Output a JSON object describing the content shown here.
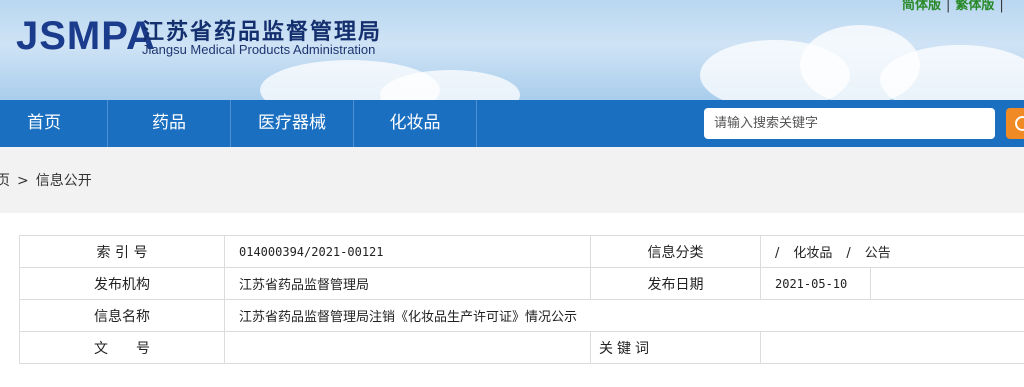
{
  "header": {
    "logo_en": "JSMPA",
    "title_cn": "江苏省药品监督管理局",
    "title_en": "Jiangsu Medical Products Administration",
    "lang_simplified": "简体版",
    "lang_traditional": "繁体版"
  },
  "nav": {
    "items": [
      {
        "label": "首页"
      },
      {
        "label": "药品"
      },
      {
        "label": "医疗器械"
      },
      {
        "label": "化妆品"
      }
    ],
    "search_placeholder": "请输入搜索关键字"
  },
  "breadcrumb": {
    "home": "页",
    "separator": ">",
    "current": "信息公开"
  },
  "info_table": {
    "index_label": "索 引 号",
    "index_value": "014000394/2021-00121",
    "category_label": "信息分类",
    "category_values": [
      "/",
      "化妆品",
      "/",
      "公告"
    ],
    "publisher_label": "发布机构",
    "publisher_value": "江苏省药品监督管理局",
    "date_label": "发布日期",
    "date_value": "2021-05-10",
    "name_label": "信息名称",
    "name_value": "江苏省药品监督管理局注销《化妆品生产许可证》情况公示",
    "doc_label": "文　　号",
    "doc_value": "",
    "keyword_label": "关键词",
    "keyword_value": ""
  },
  "colors": {
    "nav_bg": "#1a6fc0",
    "logo": "#1b3c8c",
    "search_button": "#f08a24",
    "lang_link": "#2a8a2a"
  }
}
